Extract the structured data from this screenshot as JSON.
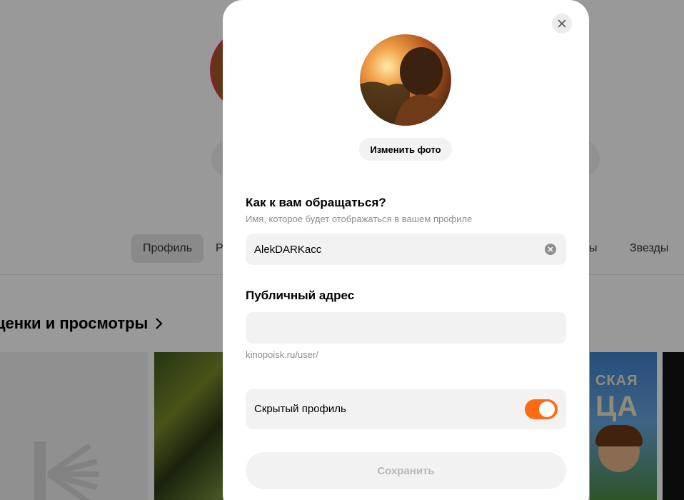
{
  "background": {
    "tabs": [
      {
        "label": "Профиль"
      },
      {
        "label": "Р"
      },
      {
        "label": "мы"
      },
      {
        "label": "Звезды"
      }
    ],
    "section_title": "ценки и просмотры",
    "poster_text_top": "СКАЯ",
    "poster_text_bottom": "ЦА"
  },
  "modal": {
    "close_icon": "close-icon",
    "change_photo_label": "Изменить фото",
    "name_field": {
      "title": "Как к вам обращаться?",
      "subtitle": "Имя, которое будет отображаться в вашем профиле",
      "value": "AlekDARKacc"
    },
    "address_field": {
      "title": "Публичный адрес",
      "value": "",
      "hint": "kinopoisk.ru/user/"
    },
    "hidden_profile": {
      "label": "Скрытый профиль",
      "enabled": true
    },
    "save_label": "Сохранить",
    "colors": {
      "toggle_on": "#ff6b12",
      "field_bg": "#f2f2f2"
    }
  }
}
